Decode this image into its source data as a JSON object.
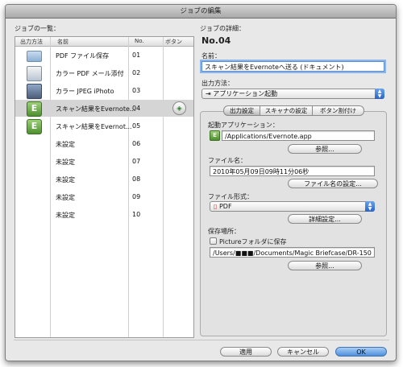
{
  "window": {
    "title": "ジョブの編集"
  },
  "left": {
    "heading": "ジョブの一覧：",
    "columns": {
      "method": "出力方法",
      "name": "名前",
      "no": "No.",
      "button": "ボタン"
    },
    "rows": [
      {
        "icon": "folder-icon",
        "name": "PDF ファイル保存",
        "no": "01"
      },
      {
        "icon": "mail-attach-icon",
        "name": "カラー PDF メール添付",
        "no": "02"
      },
      {
        "icon": "iphoto-icon",
        "name": "カラー JPEG iPhoto",
        "no": "03"
      },
      {
        "icon": "evernote-icon",
        "name": "スキャン結果をEvernote...",
        "no": "04",
        "selected": true
      },
      {
        "icon": "evernote-icon",
        "name": "スキャン結果をEvernot...",
        "no": "05"
      },
      {
        "icon": "",
        "name": "未設定",
        "no": "06"
      },
      {
        "icon": "",
        "name": "未設定",
        "no": "07"
      },
      {
        "icon": "",
        "name": "未設定",
        "no": "08"
      },
      {
        "icon": "",
        "name": "未設定",
        "no": "09"
      },
      {
        "icon": "",
        "name": "未設定",
        "no": "10"
      }
    ]
  },
  "right": {
    "heading": "ジョブの詳細：",
    "job_no": "No.04",
    "name_label": "名前：",
    "name_value": "スキャン結果をEvernoteへ送る (ドキュメント)",
    "method_label": "出力方法：",
    "method_value": "アプリケーション起動",
    "tabs": [
      "出力設定",
      "スキャナの設定",
      "ボタン割付け"
    ],
    "app_label": "起動アプリケーション：",
    "app_value": "/Applications/Evernote.app",
    "browse_label": "参照...",
    "filename_label": "ファイル名：",
    "filename_value": "2010年05月09日09時11分06秒",
    "filename_settings_label": "ファイル名の設定...",
    "format_label": "ファイル形式：",
    "format_value": "PDF",
    "detail_settings_label": "詳細設定...",
    "save_label": "保存場所：",
    "picture_folder_label": "Pictureフォルダに保存",
    "save_path": "/Users/■■■/Documents/Magic Briefcase/DR-150",
    "browse2_label": "参照..."
  },
  "footer": {
    "apply": "適用",
    "cancel": "キャンセル",
    "ok": "OK"
  },
  "colors": {
    "accent": "#4d8fdc",
    "evernote": "#4e8f2f",
    "selection": "#d5d5d5"
  }
}
